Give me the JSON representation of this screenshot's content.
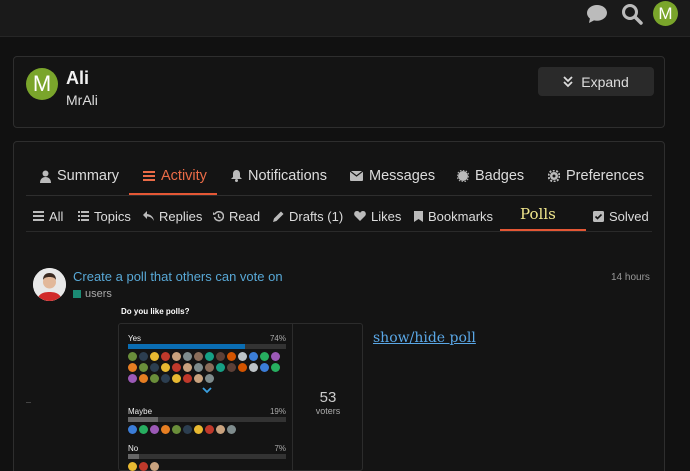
{
  "header": {
    "chat_icon": "chat-bubble-icon",
    "search_icon": "search-icon",
    "avatar_letter": "M",
    "avatar_color": "#7aa52b"
  },
  "profile": {
    "avatar_letter": "M",
    "name": "Ali",
    "username": "MrAli",
    "expand_label": "Expand"
  },
  "tabs": [
    {
      "label": "Summary",
      "icon": "user-icon"
    },
    {
      "label": "Activity",
      "icon": "stream-icon",
      "active": true
    },
    {
      "label": "Notifications",
      "icon": "bell-icon"
    },
    {
      "label": "Messages",
      "icon": "envelope-icon"
    },
    {
      "label": "Badges",
      "icon": "certificate-icon"
    },
    {
      "label": "Preferences",
      "icon": "gear-icon"
    }
  ],
  "subtabs": [
    {
      "label": "All",
      "icon": "bars-icon"
    },
    {
      "label": "Topics",
      "icon": "list-icon"
    },
    {
      "label": "Replies",
      "icon": "reply-icon"
    },
    {
      "label": "Read",
      "icon": "history-icon"
    },
    {
      "label": "Drafts (1)",
      "icon": "pencil-icon"
    },
    {
      "label": "Likes",
      "icon": "heart-icon"
    },
    {
      "label": "Bookmarks",
      "icon": "bookmark-icon"
    },
    {
      "label": "Polls",
      "active": true
    },
    {
      "label": "Solved",
      "icon": "check-square-icon"
    }
  ],
  "post": {
    "title": "Create a poll that others can vote on",
    "category": "users",
    "category_color": "#1b8a74",
    "time": "14 hours"
  },
  "poll": {
    "question": "Do you like polls?",
    "options": [
      {
        "label": "Yes",
        "percent": 74,
        "pct_text": "74%",
        "color": "#0a6db3"
      },
      {
        "label": "Maybe",
        "percent": 19,
        "pct_text": "19%",
        "color": "#666666"
      },
      {
        "label": "No",
        "percent": 7,
        "pct_text": "7%",
        "color": "#666666"
      }
    ],
    "voters_count": "53",
    "voters_label": "voters",
    "show_hide": "show/hide poll"
  },
  "accent_color": "#e45735"
}
